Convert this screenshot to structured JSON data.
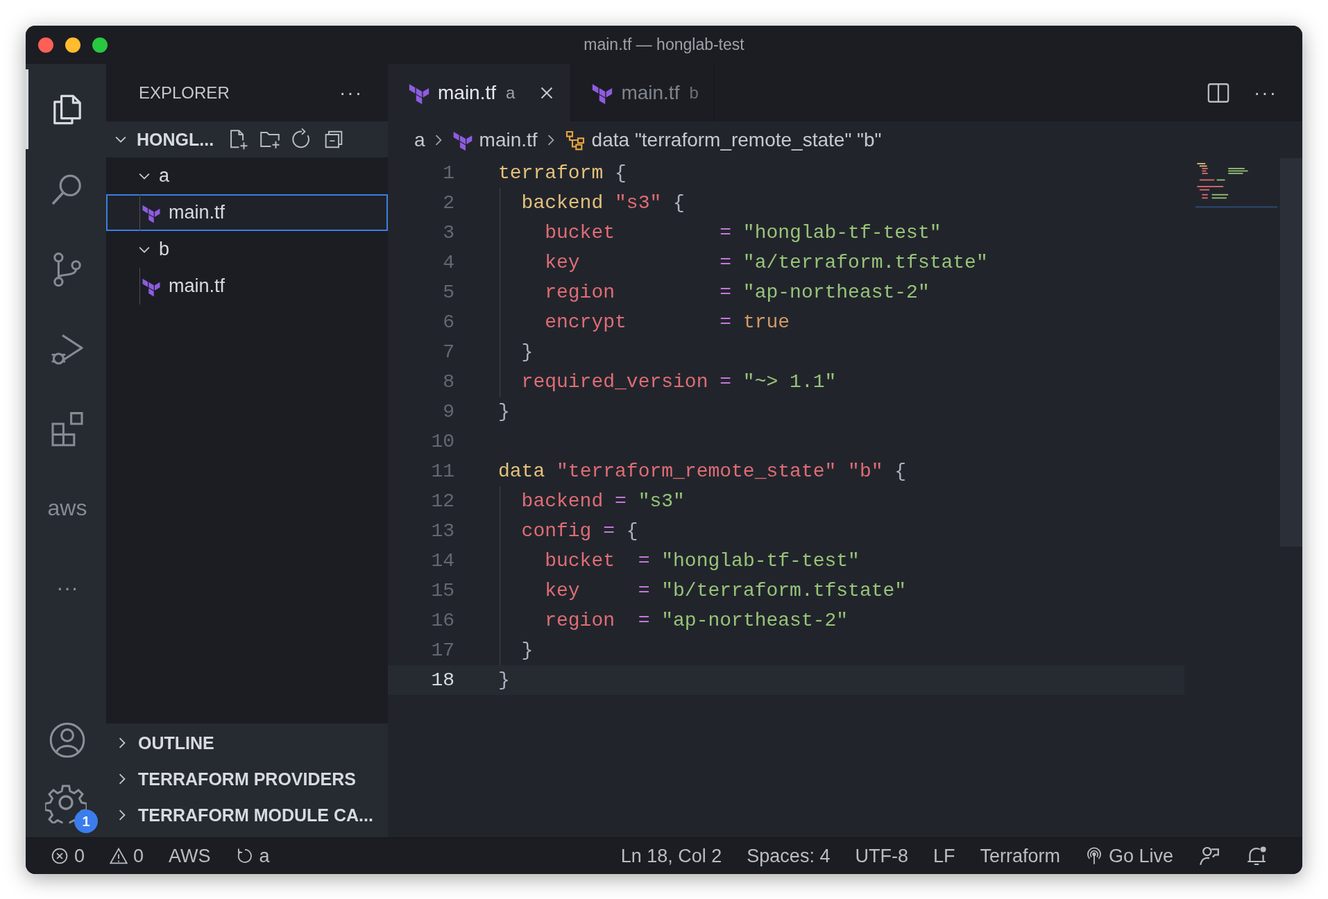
{
  "window": {
    "title": "main.tf — honglab-test"
  },
  "activity_bar": {
    "items": [
      {
        "kind": "files",
        "selected": true
      },
      {
        "kind": "search",
        "selected": false
      },
      {
        "kind": "source-control",
        "selected": false
      },
      {
        "kind": "run-debug",
        "selected": false
      },
      {
        "kind": "extensions",
        "selected": false
      },
      {
        "kind": "text",
        "label": "aws",
        "selected": false
      },
      {
        "kind": "text",
        "label": "···",
        "selected": false
      }
    ],
    "bottom": [
      {
        "kind": "account"
      },
      {
        "kind": "settings",
        "badge": "1"
      }
    ]
  },
  "sidebar": {
    "title": "EXPLORER",
    "menu": "···",
    "folder": {
      "label": "HONGL...",
      "expanded": true
    },
    "tree": [
      {
        "label": "a",
        "expanded": true,
        "children": [
          {
            "label": "main.tf",
            "selected": true
          }
        ]
      },
      {
        "label": "b",
        "expanded": true,
        "children": [
          {
            "label": "main.tf",
            "selected": false
          }
        ]
      }
    ],
    "sections": [
      {
        "label": "OUTLINE",
        "expanded": false
      },
      {
        "label": "TERRAFORM PROVIDERS",
        "expanded": false
      },
      {
        "label": "TERRAFORM MODULE CA...",
        "expanded": false
      }
    ]
  },
  "tabs": [
    {
      "label": "main.tf",
      "description": "a",
      "selected": true
    },
    {
      "label": "main.tf",
      "description": "b",
      "selected": false
    }
  ],
  "editor_actions": {
    "more": "···"
  },
  "breadcrumb": [
    {
      "kind": "folder",
      "label": "a"
    },
    {
      "kind": "file",
      "label": "main.tf"
    },
    {
      "kind": "symbol",
      "label": "data \"terraform_remote_state\" \"b\""
    }
  ],
  "code": [
    {
      "number": "1",
      "current": false,
      "tokens": [
        {
          "kind": "kw",
          "text": "terraform"
        },
        {
          "kind": "punct",
          "text": " {"
        }
      ]
    },
    {
      "number": "2",
      "current": false,
      "tokens": [
        {
          "kind": "kw",
          "text": "  backend"
        },
        {
          "kind": "label",
          "text": " \"s3\""
        },
        {
          "kind": "punct",
          "text": " {"
        }
      ]
    },
    {
      "number": "3",
      "current": false,
      "tokens": [
        {
          "kind": "attr",
          "text": "    bucket"
        },
        {
          "kind": "op",
          "text": "         ="
        },
        {
          "kind": "str",
          "text": " \"honglab-tf-test\""
        }
      ]
    },
    {
      "number": "4",
      "current": false,
      "tokens": [
        {
          "kind": "attr",
          "text": "    key"
        },
        {
          "kind": "op",
          "text": "            ="
        },
        {
          "kind": "str",
          "text": " \"a/terraform.tfstate\""
        }
      ]
    },
    {
      "number": "5",
      "current": false,
      "tokens": [
        {
          "kind": "attr",
          "text": "    region"
        },
        {
          "kind": "op",
          "text": "         ="
        },
        {
          "kind": "str",
          "text": " \"ap-northeast-2\""
        }
      ]
    },
    {
      "number": "6",
      "current": false,
      "tokens": [
        {
          "kind": "attr",
          "text": "    encrypt"
        },
        {
          "kind": "op",
          "text": "        ="
        },
        {
          "kind": "bool",
          "text": " true"
        }
      ]
    },
    {
      "number": "7",
      "current": false,
      "tokens": [
        {
          "kind": "punct",
          "text": "  }"
        }
      ]
    },
    {
      "number": "8",
      "current": false,
      "tokens": [
        {
          "kind": "attr",
          "text": "  required_version"
        },
        {
          "kind": "op",
          "text": " ="
        },
        {
          "kind": "str",
          "text": " \"~> 1.1\""
        }
      ]
    },
    {
      "number": "9",
      "current": false,
      "tokens": [
        {
          "kind": "punct",
          "text": "}"
        }
      ]
    },
    {
      "number": "10",
      "current": false
    },
    {
      "number": "11",
      "current": false,
      "tokens": [
        {
          "kind": "kw",
          "text": "data"
        },
        {
          "kind": "label",
          "text": " \"terraform_remote_state\" \"b\""
        },
        {
          "kind": "punct",
          "text": " {"
        }
      ]
    },
    {
      "number": "12",
      "current": false,
      "tokens": [
        {
          "kind": "attr",
          "text": "  backend"
        },
        {
          "kind": "op",
          "text": " ="
        },
        {
          "kind": "str",
          "text": " \"s3\""
        }
      ]
    },
    {
      "number": "13",
      "current": false,
      "tokens": [
        {
          "kind": "attr",
          "text": "  config"
        },
        {
          "kind": "op",
          "text": " ="
        },
        {
          "kind": "punct",
          "text": " {"
        }
      ]
    },
    {
      "number": "14",
      "current": false,
      "tokens": [
        {
          "kind": "attr",
          "text": "    bucket"
        },
        {
          "kind": "op",
          "text": "  ="
        },
        {
          "kind": "str",
          "text": " \"honglab-tf-test\""
        }
      ]
    },
    {
      "number": "15",
      "current": false,
      "tokens": [
        {
          "kind": "attr",
          "text": "    key"
        },
        {
          "kind": "op",
          "text": "     ="
        },
        {
          "kind": "str",
          "text": " \"b/terraform.tfstate\""
        }
      ]
    },
    {
      "number": "16",
      "current": false,
      "tokens": [
        {
          "kind": "attr",
          "text": "    region"
        },
        {
          "kind": "op",
          "text": "  ="
        },
        {
          "kind": "str",
          "text": " \"ap-northeast-2\""
        }
      ]
    },
    {
      "number": "17",
      "current": false,
      "tokens": [
        {
          "kind": "punct",
          "text": "  }"
        }
      ]
    },
    {
      "number": "18",
      "current": true,
      "tokens": [
        {
          "kind": "punct",
          "text": "}"
        }
      ]
    }
  ],
  "status_bar": {
    "left": [
      {
        "kind": "errors",
        "label": "0"
      },
      {
        "kind": "warnings",
        "label": "0"
      },
      {
        "kind": "text",
        "label": "AWS"
      },
      {
        "kind": "sync",
        "label": "a"
      }
    ],
    "right": [
      {
        "kind": "text",
        "label": "Ln 18, Col 2"
      },
      {
        "kind": "text",
        "label": "Spaces: 4"
      },
      {
        "kind": "text",
        "label": "UTF-8"
      },
      {
        "kind": "text",
        "label": "LF"
      },
      {
        "kind": "text",
        "label": "Terraform"
      },
      {
        "kind": "broadcast",
        "label": "Go Live"
      },
      {
        "kind": "feedback"
      },
      {
        "kind": "bell"
      }
    ]
  }
}
